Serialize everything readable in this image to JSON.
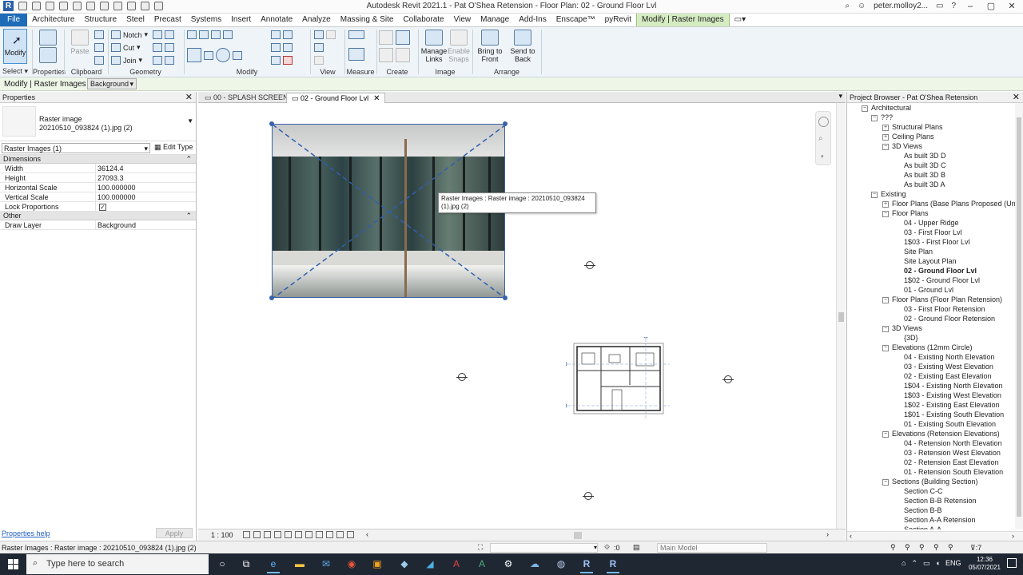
{
  "window": {
    "title": "Autodesk Revit 2021.1 - Pat O'Shea Retension - Floor Plan: 02 - Ground Floor Lvl",
    "user": "peter.molloy2..."
  },
  "ribbon_tabs": [
    "File",
    "Architecture",
    "Structure",
    "Steel",
    "Precast",
    "Systems",
    "Insert",
    "Annotate",
    "Analyze",
    "Massing & Site",
    "Collaborate",
    "View",
    "Manage",
    "Add-Ins",
    "Enscape™",
    "pyRevit",
    "Modify | Raster Images"
  ],
  "ribbon": {
    "modify": "Modify",
    "select": "Select",
    "properties": "Properties",
    "clipboard": "Clipboard",
    "paste": "Paste",
    "notch": "Notch",
    "cut": "Cut",
    "join": "Join",
    "geometry": "Geometry",
    "modify_group": "Modify",
    "view": "View",
    "measure": "Measure",
    "create": "Create",
    "manage_links": "Manage Links",
    "enable_snaps": "Enable Snaps",
    "image": "Image",
    "bring_to_front": "Bring to Front",
    "send_to_back": "Send to Back",
    "arrange": "Arrange"
  },
  "options_bar": {
    "context": "Modify | Raster Images",
    "draw_layer": "Background"
  },
  "properties": {
    "title": "Properties",
    "type_line1": "Raster image",
    "type_line2": "20210510_093824 (1).jpg (2)",
    "instance": "Raster Images (1)",
    "edit_type": "Edit Type",
    "section_dimensions": "Dimensions",
    "rows": [
      {
        "name": "Width",
        "value": "36124.4"
      },
      {
        "name": "Height",
        "value": "27093.3"
      },
      {
        "name": "Horizontal Scale",
        "value": "100.000000"
      },
      {
        "name": "Vertical Scale",
        "value": "100.000000"
      },
      {
        "name": "Lock Proportions",
        "value": "✓"
      }
    ],
    "section_other": "Other",
    "other_rows": [
      {
        "name": "Draw Layer",
        "value": "Background"
      }
    ],
    "help": "Properties help",
    "apply": "Apply"
  },
  "view_tabs": [
    {
      "label": "00 - SPLASH SCREEN"
    },
    {
      "label": "02 - Ground Floor Lvl"
    }
  ],
  "canvas": {
    "tooltip": "Raster Images : Raster image : 20210510_093824 (1).jpg (2)"
  },
  "view_control": {
    "scale": "1 : 100"
  },
  "browser": {
    "title": "Project Browser - Pat O'Shea Retension",
    "items": [
      {
        "label": "Architectural",
        "level": 1,
        "toggle": "−"
      },
      {
        "label": "???",
        "level": 2,
        "toggle": "−"
      },
      {
        "label": "Structural Plans",
        "level": 3,
        "toggle": "+"
      },
      {
        "label": "Ceiling Plans",
        "level": 3,
        "toggle": "+"
      },
      {
        "label": "3D Views",
        "level": 3,
        "toggle": "−"
      },
      {
        "label": "As built 3D  D",
        "level": 4,
        "toggle": ""
      },
      {
        "label": "As built 3D  C",
        "level": 4,
        "toggle": ""
      },
      {
        "label": "As built 3D  B",
        "level": 4,
        "toggle": ""
      },
      {
        "label": "As built 3D  A",
        "level": 4,
        "toggle": ""
      },
      {
        "label": "Existing",
        "level": 2,
        "toggle": "−"
      },
      {
        "label": "Floor Plans (Base Plans Proposed (Unused)",
        "level": 3,
        "toggle": "+"
      },
      {
        "label": "Floor Plans",
        "level": 3,
        "toggle": "−"
      },
      {
        "label": "04 - Upper Ridge",
        "level": 4,
        "toggle": ""
      },
      {
        "label": "03 - First Floor Lvl",
        "level": 4,
        "toggle": ""
      },
      {
        "label": "1$03 - First Floor Lvl",
        "level": 4,
        "toggle": ""
      },
      {
        "label": "Site Plan",
        "level": 4,
        "toggle": ""
      },
      {
        "label": "Site Layout Plan",
        "level": 4,
        "toggle": ""
      },
      {
        "label": "02 - Ground Floor Lvl",
        "level": 4,
        "toggle": "",
        "bold": true
      },
      {
        "label": "1$02 - Ground Floor Lvl",
        "level": 4,
        "toggle": ""
      },
      {
        "label": "01 - Ground Lvl",
        "level": 4,
        "toggle": ""
      },
      {
        "label": "Floor Plans (Floor Plan Retension)",
        "level": 3,
        "toggle": "−"
      },
      {
        "label": "03 - First Floor Retension",
        "level": 4,
        "toggle": ""
      },
      {
        "label": "02 - Ground Floor Retension",
        "level": 4,
        "toggle": ""
      },
      {
        "label": "3D Views",
        "level": 3,
        "toggle": "−"
      },
      {
        "label": "{3D}",
        "level": 4,
        "toggle": ""
      },
      {
        "label": "Elevations (12mm Circle)",
        "level": 3,
        "toggle": "−"
      },
      {
        "label": "04 - Existing North Elevation",
        "level": 4,
        "toggle": ""
      },
      {
        "label": "03 - Existing West Elevation",
        "level": 4,
        "toggle": ""
      },
      {
        "label": "02 - Existing East Elevation",
        "level": 4,
        "toggle": ""
      },
      {
        "label": "1$04 - Existing North Elevation",
        "level": 4,
        "toggle": ""
      },
      {
        "label": "1$03 - Existing West Elevation",
        "level": 4,
        "toggle": ""
      },
      {
        "label": "1$02 - Existing East Elevation",
        "level": 4,
        "toggle": ""
      },
      {
        "label": "1$01 - Existing South Elevation",
        "level": 4,
        "toggle": ""
      },
      {
        "label": "01 - Existing South Elevation",
        "level": 4,
        "toggle": ""
      },
      {
        "label": "Elevations (Retension Elevations)",
        "level": 3,
        "toggle": "−"
      },
      {
        "label": "04 - Retension North Elevation",
        "level": 4,
        "toggle": ""
      },
      {
        "label": "03 - Retension West Elevation",
        "level": 4,
        "toggle": ""
      },
      {
        "label": "02 - Retension East Elevation",
        "level": 4,
        "toggle": ""
      },
      {
        "label": "01 - Retension South Elevation",
        "level": 4,
        "toggle": ""
      },
      {
        "label": "Sections (Building Section)",
        "level": 3,
        "toggle": "−"
      },
      {
        "label": "Section C-C",
        "level": 4,
        "toggle": ""
      },
      {
        "label": "Section B-B Retension",
        "level": 4,
        "toggle": ""
      },
      {
        "label": "Section B-B",
        "level": 4,
        "toggle": ""
      },
      {
        "label": "Section A-A Retension",
        "level": 4,
        "toggle": ""
      },
      {
        "label": "Section A-A",
        "level": 4,
        "toggle": ""
      }
    ]
  },
  "status": {
    "message": "Raster Images : Raster image : 20210510_093824 (1).jpg (2)",
    "zero": ":0",
    "model": "Main Model",
    "filter": "7"
  },
  "taskbar": {
    "search_placeholder": "Type here to search",
    "lang": "ENG",
    "time": "12:36",
    "date": "05/07/2021"
  }
}
